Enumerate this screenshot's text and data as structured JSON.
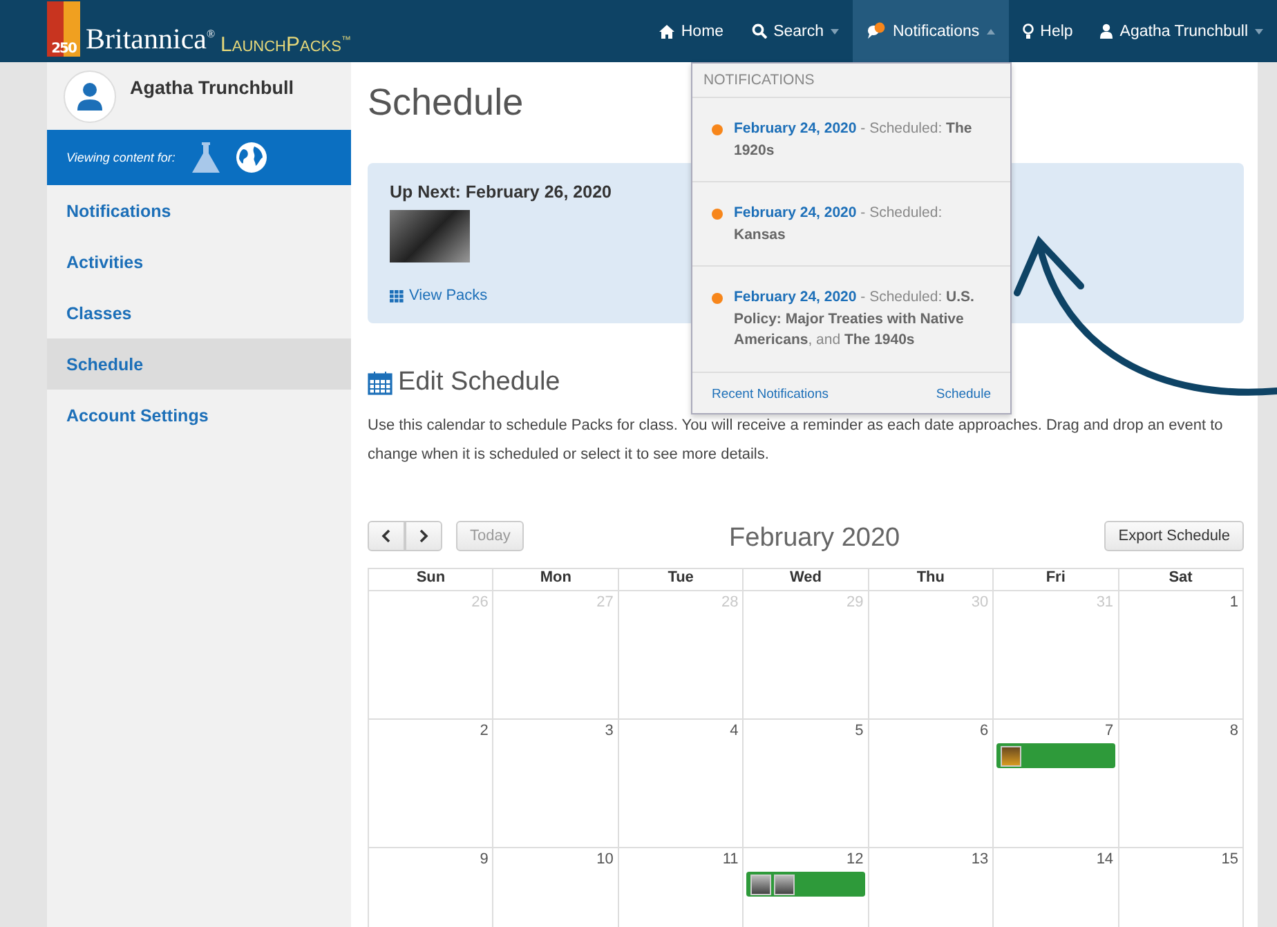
{
  "logo": {
    "badge": "250",
    "brand": "Britannica$^{®}$",
    "product": "LaunchPacks$^{™}$"
  },
  "nav": [
    {
      "kind": "home",
      "label": "Home",
      "dropdown": false,
      "selected": false
    },
    {
      "kind": "search",
      "label": "Search",
      "dropdown": true,
      "selected": false
    },
    {
      "kind": "notifications",
      "label": "Notifications",
      "dropdown": true,
      "selected": true
    },
    {
      "kind": "help",
      "label": "Help",
      "dropdown": false,
      "selected": false
    },
    {
      "kind": "user",
      "label": "Agatha Trunchbull",
      "dropdown": true,
      "selected": false
    }
  ],
  "notifications_menu": {
    "heading": "NOTIFICATIONS",
    "items": [
      {
        "date": "February 24, 2020",
        "text": "- Scheduled: **The 1920s**",
        "unread": true
      },
      {
        "date": "February 24, 2020",
        "text": "- Scheduled: **Kansas**",
        "unread": true
      },
      {
        "date": "February 24, 2020",
        "text": "- Scheduled: **U.S. Policy: Major Treaties with Native Americans**, and **The 1940s**",
        "unread": true
      }
    ],
    "footer_links": [
      "Recent Notifications",
      "Schedule"
    ]
  },
  "sidebar": {
    "user_name": "Agatha Trunchbull",
    "viewing_label": "Viewing content for:",
    "items": [
      {
        "label": "Notifications",
        "selected": false
      },
      {
        "label": "Activities",
        "selected": false
      },
      {
        "label": "Classes",
        "selected": false
      },
      {
        "label": "Schedule",
        "selected": true
      },
      {
        "label": "Account Settings",
        "selected": false
      }
    ]
  },
  "page_title": "Schedule",
  "up_next": {
    "title": "Up Next: February 26, 2020",
    "link": "View Packs"
  },
  "edit_schedule": {
    "title": "Edit Schedule",
    "description": "Use this calendar to schedule Packs for class. You will receive a reminder as each date approaches. Drag and drop an event to change when it is scheduled or select it to see more details."
  },
  "calendar": {
    "month": "February 2020",
    "today_button": "Today",
    "today_disabled": true,
    "export_button": "Export Schedule",
    "weekdays": [
      "Sun",
      "Mon",
      "Tue",
      "Wed",
      "Thu",
      "Fri",
      "Sat"
    ],
    "weeks": [
      [
        {
          "day": "26",
          "other_month": true
        },
        {
          "day": "27",
          "other_month": true
        },
        {
          "day": "28",
          "other_month": true
        },
        {
          "day": "29",
          "other_month": true
        },
        {
          "day": "30",
          "other_month": true
        },
        {
          "day": "31",
          "other_month": true
        },
        {
          "day": "1",
          "other_month": false
        }
      ],
      [
        {
          "day": "2",
          "other_month": false
        },
        {
          "day": "3",
          "other_month": false
        },
        {
          "day": "4",
          "other_month": false
        },
        {
          "day": "5",
          "other_month": false
        },
        {
          "day": "6",
          "other_month": false
        },
        {
          "day": "7",
          "other_month": false,
          "events": [
            {
              "photos": [
                {
                  "kind": "color"
                }
              ]
            }
          ]
        },
        {
          "day": "8",
          "other_month": false
        }
      ],
      [
        {
          "day": "9",
          "other_month": false
        },
        {
          "day": "10",
          "other_month": false
        },
        {
          "day": "11",
          "other_month": false
        },
        {
          "day": "12",
          "other_month": false,
          "events": [
            {
              "photos": [
                {
                  "kind": "gray"
                },
                {
                  "kind": "gray"
                }
              ]
            }
          ]
        },
        {
          "day": "13",
          "other_month": false
        },
        {
          "day": "14",
          "other_month": false
        },
        {
          "day": "15",
          "other_month": false
        }
      ]
    ]
  }
}
